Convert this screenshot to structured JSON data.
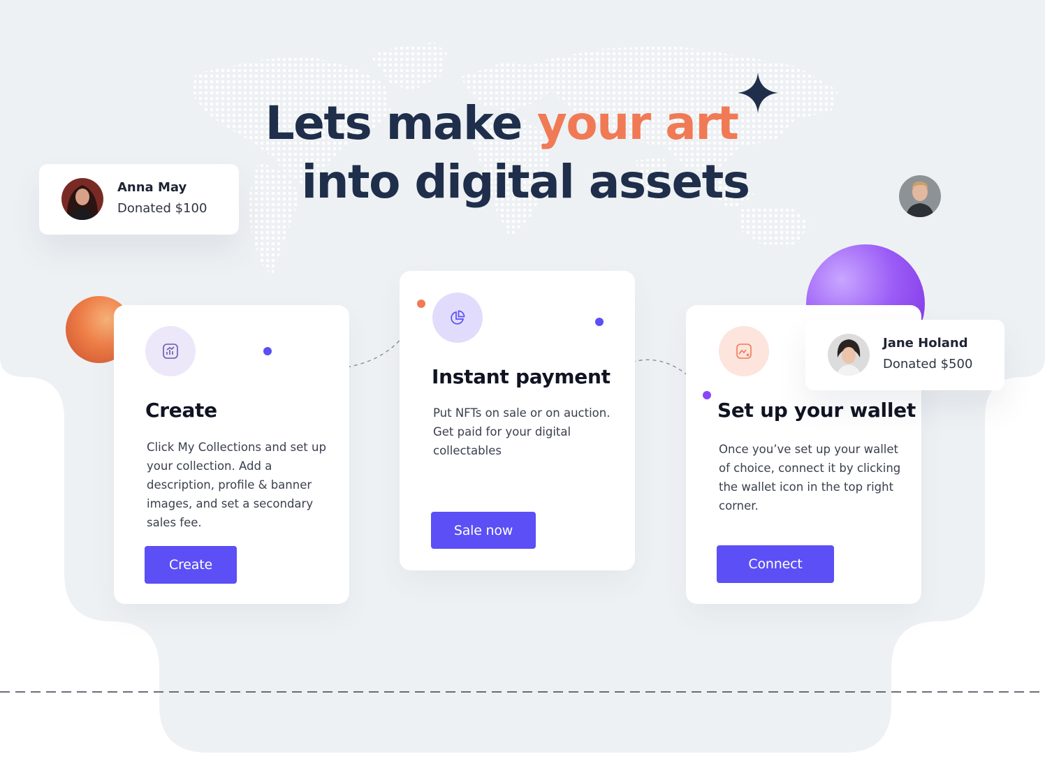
{
  "headline": {
    "line1_prefix": "Lets make",
    "line1_accent": "your art",
    "line2": "into digital assets"
  },
  "donors": [
    {
      "name": "Anna May",
      "amount": "Donated $100"
    },
    {
      "name": "Jane Holand",
      "amount": "Donated $500"
    }
  ],
  "cards": [
    {
      "title": "Create",
      "text": "Click My Collections and set up your collection. Add a description, profile & banner images, and set a secondary sales fee.",
      "button": "Create",
      "icon": "chart-icon"
    },
    {
      "title": "Instant payment",
      "text": "Put NFTs on sale or on auction. Get paid for your digital collectables",
      "button": "Sale now",
      "icon": "pie-chart-icon"
    },
    {
      "title": "Set up your wallet",
      "text": "Once you’ve set up your wallet of choice, connect it by clicking the wallet icon in the top right corner.",
      "button": "Connect",
      "icon": "image-star-icon"
    }
  ],
  "colors": {
    "heading": "#1f2e4a",
    "accent": "#f07a55",
    "button": "#5b4ff5",
    "background_shape": "#eef1f4"
  }
}
